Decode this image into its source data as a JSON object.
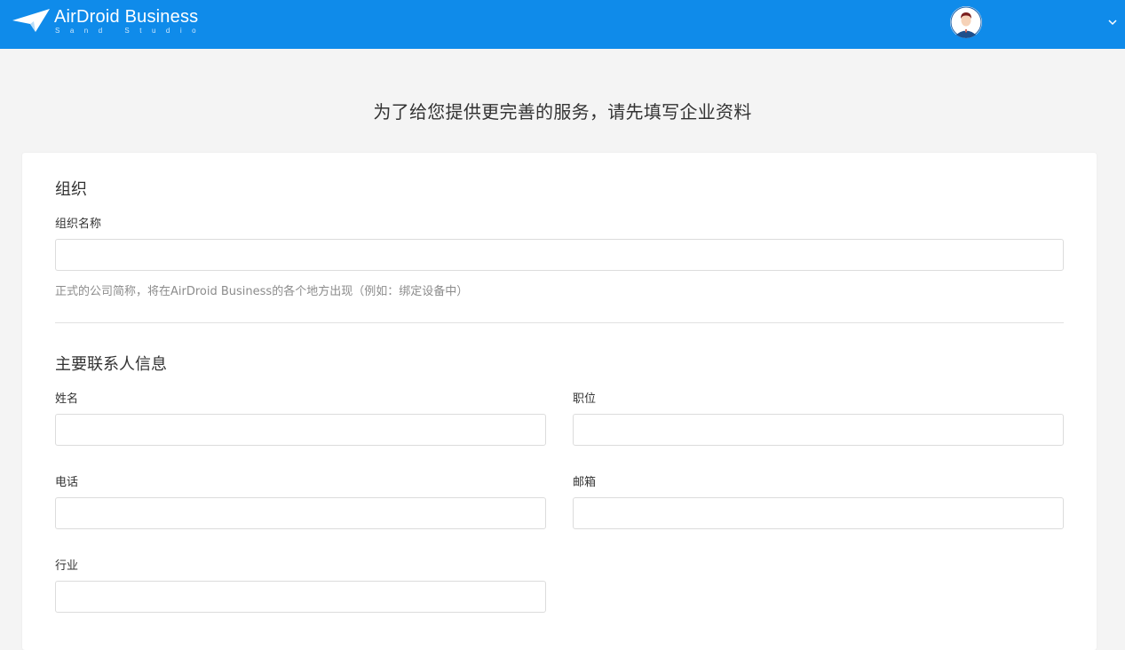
{
  "header": {
    "brand_name": "AirDroid Business",
    "brand_sub": "Sand Studio",
    "accent_color": "#0f8bea",
    "avatar_icon": "user-avatar-icon",
    "menu_icon": "chevron-down-icon"
  },
  "page": {
    "headline": "为了给您提供更完善的服务，请先填写企业资料"
  },
  "organization": {
    "section_title": "组织",
    "name_label": "组织名称",
    "name_value": "",
    "name_hint": "正式的公司简称，将在AirDroid Business的各个地方出现（例如：绑定设备中）"
  },
  "contact": {
    "section_title": "主要联系人信息",
    "fields": {
      "name": {
        "label": "姓名",
        "value": ""
      },
      "position": {
        "label": "职位",
        "value": ""
      },
      "phone": {
        "label": "电话",
        "value": ""
      },
      "email": {
        "label": "邮箱",
        "value": ""
      },
      "industry": {
        "label": "行业",
        "value": ""
      }
    }
  }
}
